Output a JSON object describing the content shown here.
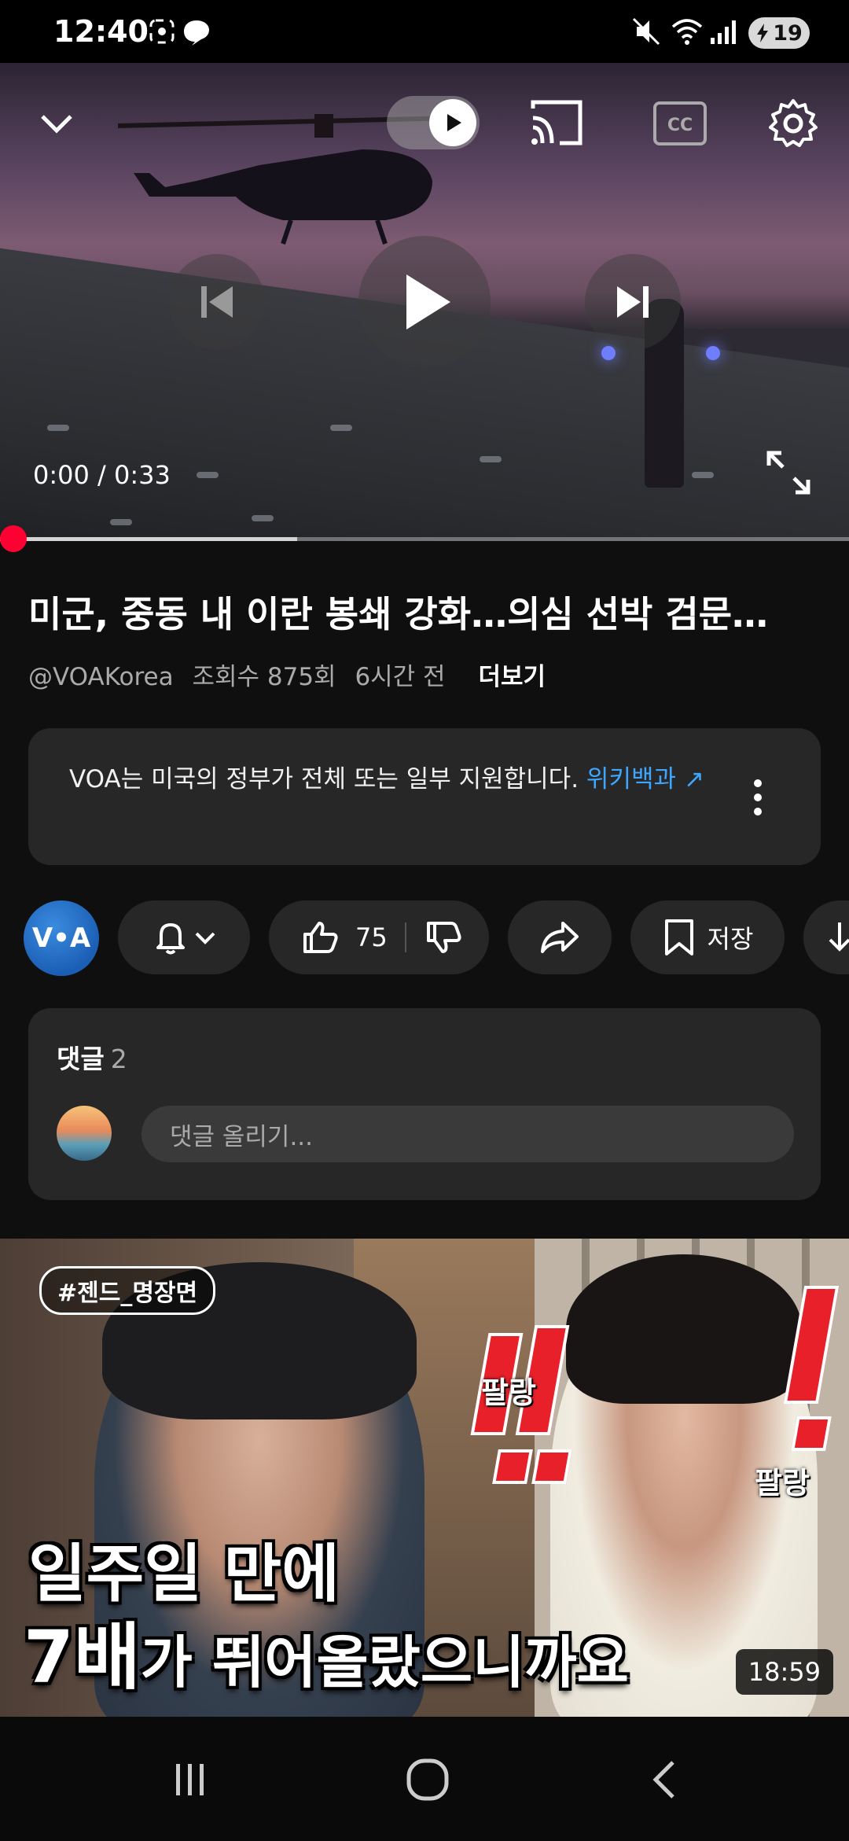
{
  "status_bar": {
    "time": "12:40",
    "battery": "19"
  },
  "player": {
    "time_current": "0:00",
    "time_separator": "/",
    "time_total": "0:33",
    "progress_fraction": 0.0,
    "buffer_fraction": 0.35
  },
  "video": {
    "title": "미군, 중동 내 이란 봉쇄 강화…의심 선박 검문…",
    "channel": "@VOAKorea",
    "views": "조회수 875회",
    "age": "6시간 전",
    "more_label": "더보기"
  },
  "info_card": {
    "text": "VOA는 미국의 정부가 전체 또는 일부 지원합니다. ",
    "link_text": "위키백과",
    "link_arrow": "↗"
  },
  "actions": {
    "channel_avatar_text": "V•A",
    "like_count": "75",
    "save_label": "저장"
  },
  "comments": {
    "label": "댓글",
    "count": "2",
    "placeholder": "댓글 올리기..."
  },
  "next_video": {
    "hashtag": "#젠드_명장면",
    "sfx_left": "팔랑",
    "sfx_right": "팔랑",
    "caption_line1": "일주일 만에",
    "caption_line2_a": "7배",
    "caption_line2_b": "가 뛰어올랐으니까요",
    "duration": "18:59"
  },
  "colors": {
    "background": "#0f0f0f",
    "card": "#272727",
    "accent_red": "#ff0033",
    "link_blue": "#3ea6ff"
  }
}
